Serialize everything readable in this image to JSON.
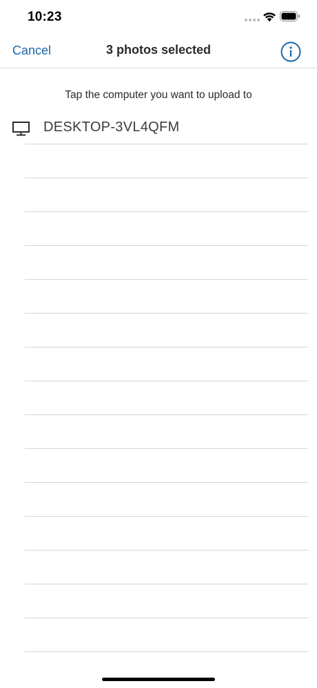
{
  "status_bar": {
    "time": "10:23"
  },
  "nav": {
    "cancel_label": "Cancel",
    "title": "3 photos selected",
    "info_icon": "info-circle-icon"
  },
  "content": {
    "instruction": "Tap the computer you want to upload to",
    "computers": [
      {
        "name": "DESKTOP-3VL4QFM",
        "icon": "monitor-icon"
      }
    ]
  },
  "colors": {
    "accent": "#1a66a8",
    "separator": "#d5d5d8",
    "text": "#2b2b2b"
  }
}
